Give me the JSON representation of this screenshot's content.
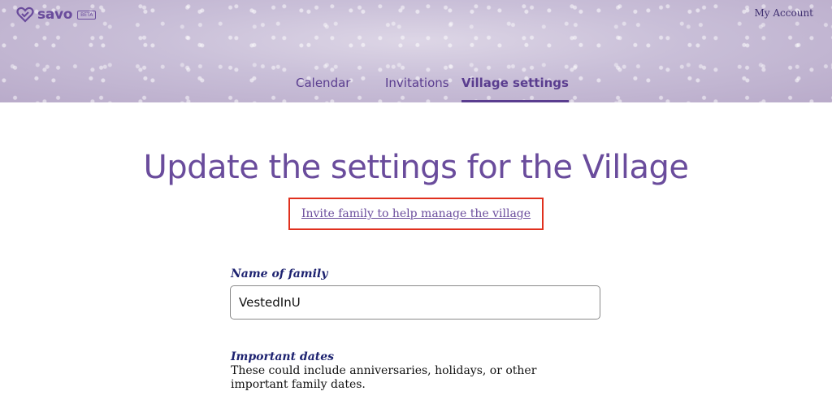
{
  "header": {
    "logo_text": "savo",
    "beta_label": "BETA",
    "account_link": "My Account",
    "brand_color": "#6a4c9c"
  },
  "tabs": [
    {
      "label": "Calendar",
      "active": false
    },
    {
      "label": "Invitations",
      "active": false
    },
    {
      "label": "Village settings",
      "active": true
    }
  ],
  "main": {
    "title": "Update the settings for the Village",
    "invite_link": "Invite family to help manage the village",
    "highlight_color": "#e0301e"
  },
  "form": {
    "family_name": {
      "label": "Name of family",
      "value": "VestedInU"
    },
    "important_dates": {
      "label": "Important dates",
      "help": "These could include anniversaries, holidays, or other important family dates."
    }
  },
  "icons": {
    "logo_icon": "heart-check-icon"
  }
}
